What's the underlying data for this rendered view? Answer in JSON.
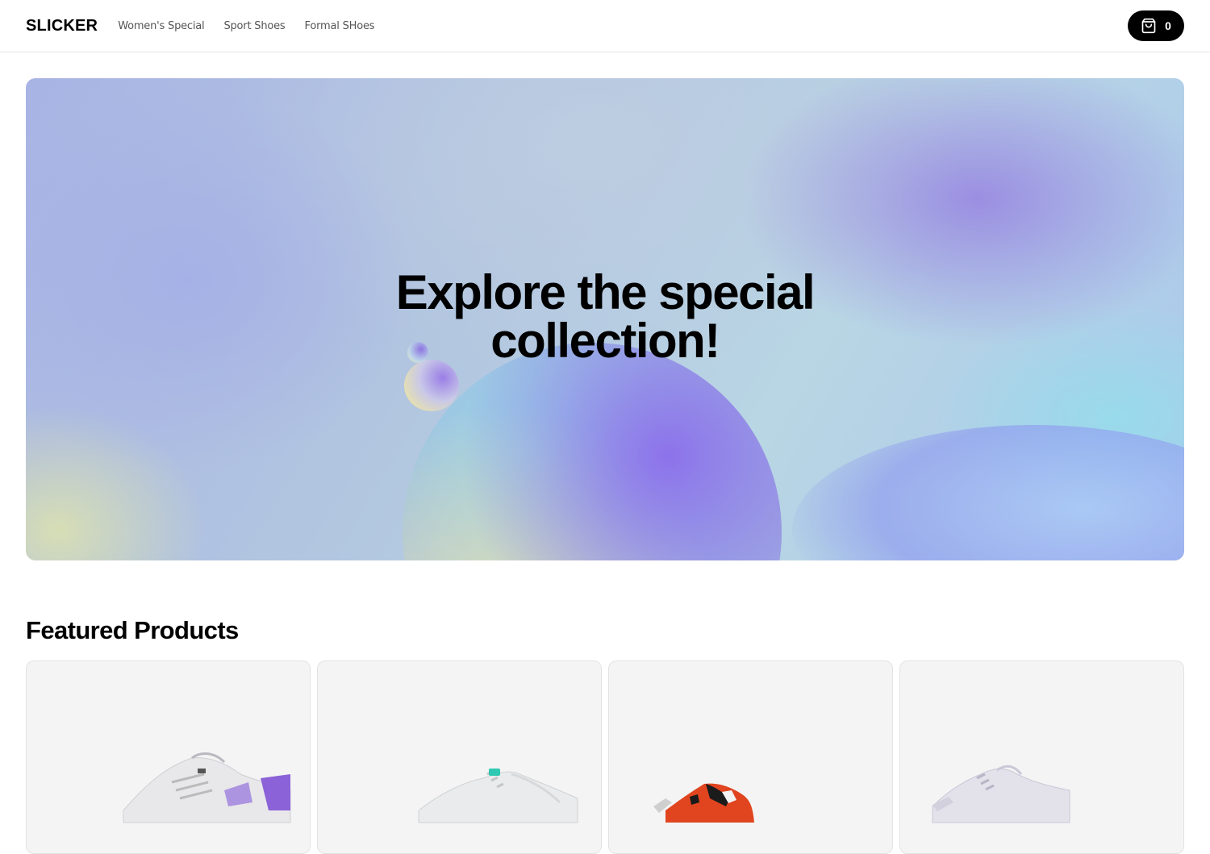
{
  "header": {
    "logo": "SLICKER",
    "nav": [
      "Women's Special",
      "Sport Shoes",
      "Formal SHoes"
    ],
    "cart_count": "0"
  },
  "hero": {
    "title_line1": "Explore the special",
    "title_line2": "collection!"
  },
  "featured": {
    "title": "Featured Products",
    "products": [
      {
        "accent": "#8b62d8",
        "icon": "white-sneaker-purple-accent"
      },
      {
        "accent": "#2fc9b3",
        "icon": "white-sneaker-teal-accent"
      },
      {
        "accent": "#e0451f",
        "icon": "orange-black-sneaker"
      },
      {
        "accent": "#c9c9d8",
        "icon": "lavender-white-sneaker"
      }
    ]
  }
}
